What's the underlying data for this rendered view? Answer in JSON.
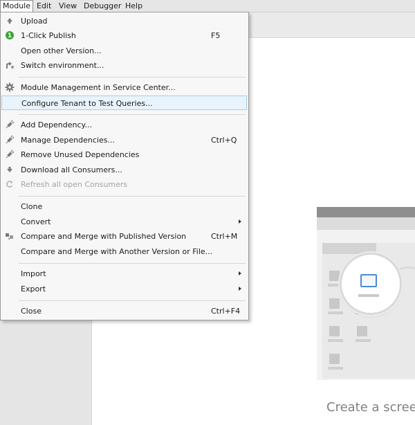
{
  "menubar": {
    "module": "Module",
    "edit": "Edit",
    "view": "View",
    "debugger": "Debugger",
    "help": "Help"
  },
  "menu": {
    "upload": "Upload",
    "one_click_publish": "1-Click Publish",
    "one_click_publish_shortcut": "F5",
    "one_click_badge": "1",
    "open_other_version": "Open other Version...",
    "switch_environment": "Switch environment...",
    "module_management": "Module Management in Service Center...",
    "configure_tenant": "Configure Tenant to Test Queries...",
    "add_dependency": "Add Dependency...",
    "manage_dependencies": "Manage Dependencies...",
    "manage_dependencies_shortcut": "Ctrl+Q",
    "remove_unused_dependencies": "Remove Unused Dependencies",
    "download_all_consumers": "Download all Consumers...",
    "refresh_all_open_consumers": "Refresh all open Consumers",
    "clone": "Clone",
    "convert": "Convert",
    "compare_merge_published": "Compare and Merge with Published Version",
    "compare_merge_published_shortcut": "Ctrl+M",
    "compare_merge_another": "Compare and Merge with Another Version or File...",
    "import": "Import",
    "export": "Export",
    "close": "Close",
    "close_shortcut": "Ctrl+F4"
  },
  "canvas": {
    "create_screen_text": "Create a screen"
  },
  "colors": {
    "menu_highlight": "#e9f3fb",
    "menu_highlight_border": "#a9cbe7",
    "publish_green": "#3aa335",
    "icon_gray": "#7a7a7a"
  }
}
